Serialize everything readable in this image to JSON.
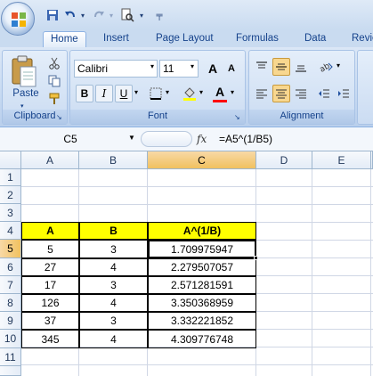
{
  "qat": {
    "icons": [
      "save-icon",
      "undo-icon",
      "redo-icon",
      "print-preview-icon",
      "customize-icon"
    ]
  },
  "tabs": [
    "Home",
    "Insert",
    "Page Layout",
    "Formulas",
    "Data",
    "Revie"
  ],
  "ribbon": {
    "clipboard": {
      "paste_label": "Paste",
      "group_label": "Clipboard"
    },
    "font": {
      "name": "Calibri",
      "size": "11",
      "group_label": "Font",
      "bold": "B",
      "italic": "I",
      "underline": "U",
      "grow": "A",
      "shrink": "A",
      "font_color_letter": "A"
    },
    "alignment": {
      "group_label": "Alignment"
    }
  },
  "formula_bar": {
    "name_box": "C5",
    "fx": "fx",
    "formula": "=A5^(1/B5)"
  },
  "columns": [
    "A",
    "B",
    "C",
    "D",
    "E"
  ],
  "rows": [
    "1",
    "2",
    "3",
    "4",
    "5",
    "6",
    "7",
    "8",
    "9",
    "10",
    "11"
  ],
  "table": {
    "headers": [
      "A",
      "B",
      "A^(1/B)"
    ],
    "rows": [
      [
        "5",
        "3",
        "1.709975947"
      ],
      [
        "27",
        "4",
        "2.279507057"
      ],
      [
        "17",
        "3",
        "2.571281591"
      ],
      [
        "126",
        "4",
        "3.350368959"
      ],
      [
        "37",
        "3",
        "3.332221852"
      ],
      [
        "345",
        "4",
        "4.309776748"
      ]
    ]
  },
  "selection": {
    "cell": "C5"
  },
  "colors": {
    "header_fill": "#ffff00",
    "selected_header": "#f1c15f",
    "ribbon": "#c7daf2"
  }
}
